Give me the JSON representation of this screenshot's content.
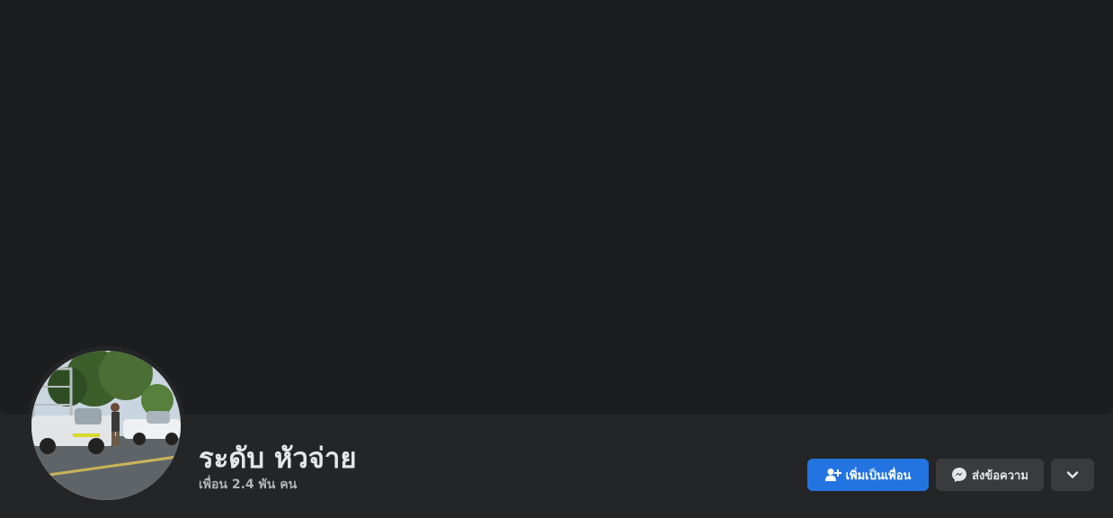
{
  "profile": {
    "name": "ระดับ หัวจ่าย",
    "friends_count": "เพื่อน 2.4 พัน คน"
  },
  "actions": {
    "add_friend_label": "เพิ่มเป็นเพื่อน",
    "message_label": "ส่งข้อความ"
  },
  "icons": {
    "add_friend": "add-friend-icon",
    "messenger": "messenger-icon",
    "more": "chevron-down-icon"
  },
  "colors": {
    "primary_button": "#2374e1",
    "secondary_button": "#3a3b3c",
    "cover": "#1c1d1f",
    "header_bg": "#242526"
  }
}
